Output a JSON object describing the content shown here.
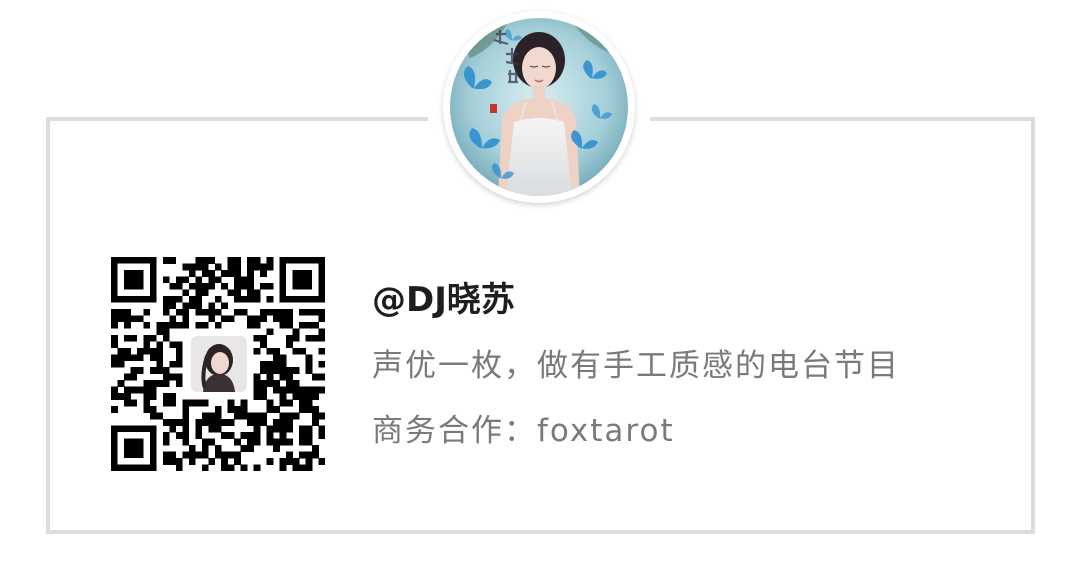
{
  "profile": {
    "handle": "@DJ晓苏",
    "tagline": "声优一枚，做有手工质感的电台节目",
    "contact": "商务合作：foxtarot"
  },
  "avatar": {
    "icon": "butterfly-portrait-avatar"
  },
  "qr": {
    "icon": "qr-code-icon",
    "center_icon": "profile-photo-icon"
  },
  "colors": {
    "border": "#dcdcdc",
    "handle_text": "#1e1e1e",
    "body_text": "#7a7a7a",
    "avatar_bg": "#9cc6d8",
    "butterfly": "#2e8fd0"
  }
}
